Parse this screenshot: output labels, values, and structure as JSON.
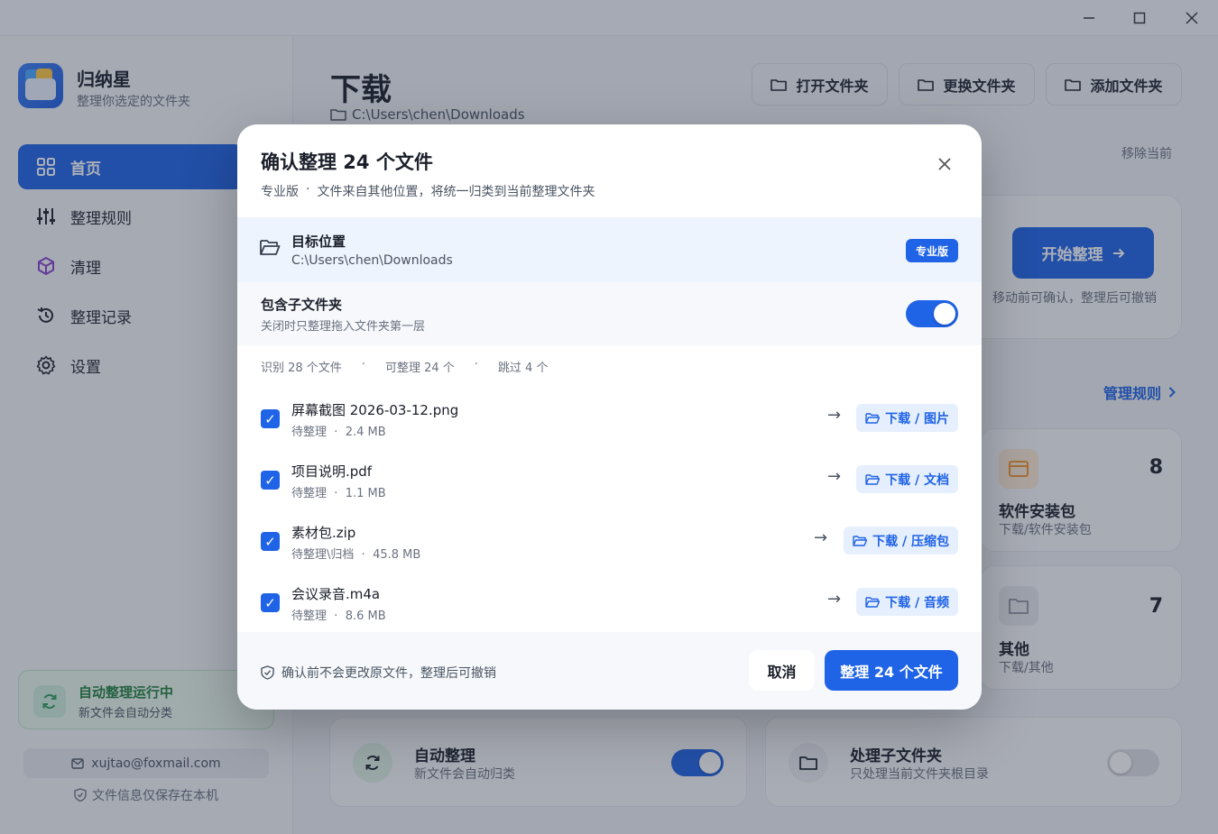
{
  "window": {
    "controls": [
      "minimize",
      "maximize",
      "close"
    ]
  },
  "brand": {
    "name": "归纳星",
    "subtitle": "整理你选定的文件夹"
  },
  "sidebar": {
    "items": [
      {
        "label": "首页",
        "icon": "grid-icon",
        "active": true
      },
      {
        "label": "整理规则",
        "icon": "sliders-icon",
        "active": false
      },
      {
        "label": "清理",
        "icon": "cube-icon",
        "active": false
      },
      {
        "label": "整理记录",
        "icon": "history-icon",
        "active": false
      },
      {
        "label": "设置",
        "icon": "gear-icon",
        "active": false
      }
    ],
    "auto_card": {
      "title": "自动整理运行中",
      "subtitle": "新文件会自动分类"
    },
    "email": "xujtao@foxmail.com",
    "local_note": "文件信息仅保存在本机"
  },
  "main": {
    "title": "下载",
    "path": "C:\\Users\\chen\\Downloads",
    "buttons": {
      "open": "打开文件夹",
      "change": "更换文件夹",
      "add": "添加文件夹"
    },
    "remove_current": "移除当前",
    "start": {
      "label": "开始整理",
      "hint": "移动前可确认，整理后可撤销"
    },
    "manage_rules": "管理规则",
    "categories": [
      {
        "name": "软件安装包",
        "path": "下载/软件安装包",
        "count": "8",
        "color": "#f08c1e"
      },
      {
        "name": "其他",
        "path": "下载/其他",
        "count": "7",
        "color": "#8a909c"
      }
    ],
    "auto_sort": {
      "title": "自动整理",
      "subtitle": "新文件会自动归类",
      "enabled": true
    },
    "subfolders": {
      "title": "处理子文件夹",
      "subtitle": "只处理当前文件夹根目录",
      "enabled": false
    }
  },
  "modal": {
    "title": "确认整理 24 个文件",
    "subtitle_edition": "专业版",
    "subtitle_sep": "·",
    "subtitle_text": "文件来自其他位置，将统一归类到当前整理文件夹",
    "target": {
      "label": "目标位置",
      "path": "C:\\Users\\chen\\Downloads",
      "badge": "专业版"
    },
    "include_sub": {
      "label": "包含子文件夹",
      "desc": "关闭时只整理拖入文件夹第一层",
      "enabled": true
    },
    "stats": {
      "identified": "识别 28 个文件",
      "sep": "·",
      "sortable": "可整理 24 个",
      "skipped": "跳过 4 个"
    },
    "files": [
      {
        "name": "屏幕截图 2026-03-12.png",
        "status": "待整理",
        "sep": "·",
        "size": "2.4 MB",
        "arrow": "→",
        "dest": "下载 / 图片",
        "checked": true
      },
      {
        "name": "项目说明.pdf",
        "status": "待整理",
        "sep": "·",
        "size": "1.1 MB",
        "arrow": "→",
        "dest": "下载 / 文档",
        "checked": true
      },
      {
        "name": "素材包.zip",
        "status": "待整理\\归档",
        "sep": "·",
        "size": "45.8 MB",
        "arrow": "→",
        "dest": "下载 / 压缩包",
        "checked": true
      },
      {
        "name": "会议录音.m4a",
        "status": "待整理",
        "sep": "·",
        "size": "8.6 MB",
        "arrow": "→",
        "dest": "下载 / 音频",
        "checked": true
      }
    ],
    "footer_note": "确认前不会更改原文件，整理后可撤销",
    "cancel": "取消",
    "confirm": "整理 24 个文件"
  },
  "colors": {
    "accent": "#1f63e6",
    "success": "#22803f"
  }
}
